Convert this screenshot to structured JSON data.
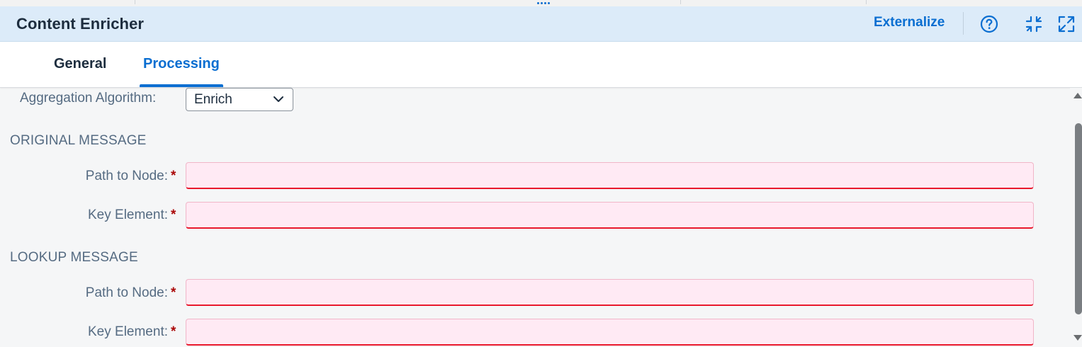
{
  "header": {
    "title": "Content Enricher",
    "externalize_label": "Externalize",
    "icons": [
      "help-icon",
      "exit-fullscreen-icon",
      "fullscreen-icon"
    ]
  },
  "tabs": [
    {
      "label": "General",
      "active": false
    },
    {
      "label": "Processing",
      "active": true
    }
  ],
  "processing": {
    "aggregation_label": "Aggregation Algorithm:",
    "aggregation_value": "Enrich",
    "original_section": "ORIGINAL MESSAGE",
    "lookup_section": "LOOKUP MESSAGE",
    "path_label": "Path to Node:",
    "key_label": "Key Element:",
    "required_marker": "*",
    "fields": {
      "original_path": "",
      "original_key": "",
      "lookup_path": "",
      "lookup_key": ""
    }
  },
  "colors": {
    "accent": "#0a6ed1",
    "header_bg": "#dcebf9",
    "error_border": "#e9192d",
    "error_bg": "#ffeaf4",
    "required": "#aa0808"
  }
}
